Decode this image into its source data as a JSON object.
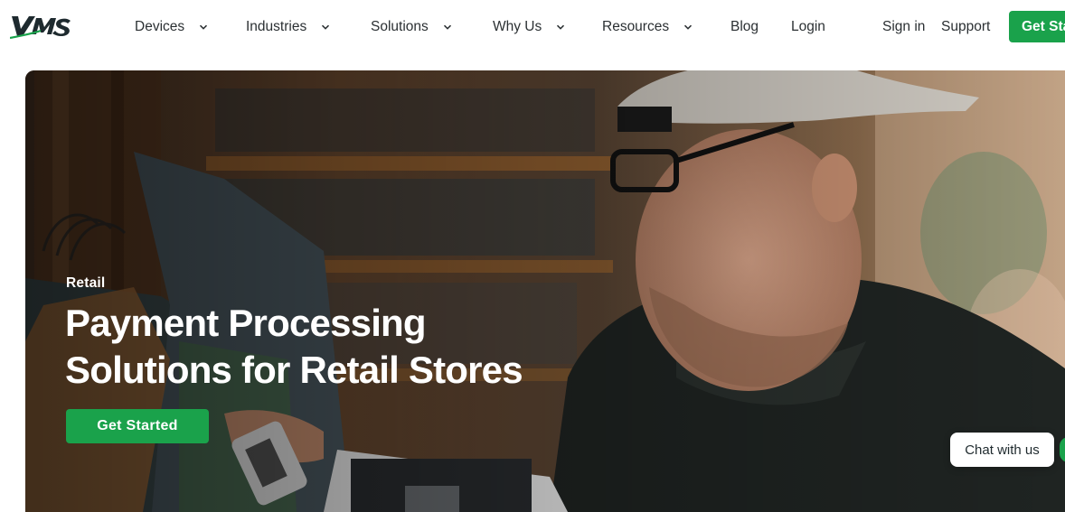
{
  "header": {
    "logo_text": "VMS",
    "nav": [
      {
        "label": "Devices",
        "has_dropdown": true
      },
      {
        "label": "Industries",
        "has_dropdown": true
      },
      {
        "label": "Solutions",
        "has_dropdown": true
      },
      {
        "label": "Why Us",
        "has_dropdown": true
      },
      {
        "label": "Resources",
        "has_dropdown": true
      },
      {
        "label": "Blog",
        "has_dropdown": false
      },
      {
        "label": "Login",
        "has_dropdown": false
      }
    ],
    "sign_in": "Sign in",
    "support": "Support",
    "cta": "Get Started"
  },
  "hero": {
    "eyebrow": "Retail",
    "title_line1": "Payment Processing",
    "title_line2": "Solutions for Retail Stores",
    "cta": "Get Started"
  },
  "chat": {
    "label": "Chat with us"
  },
  "colors": {
    "accent": "#1aa24b",
    "text": "#2b3033",
    "hero_text": "#ffffff"
  }
}
